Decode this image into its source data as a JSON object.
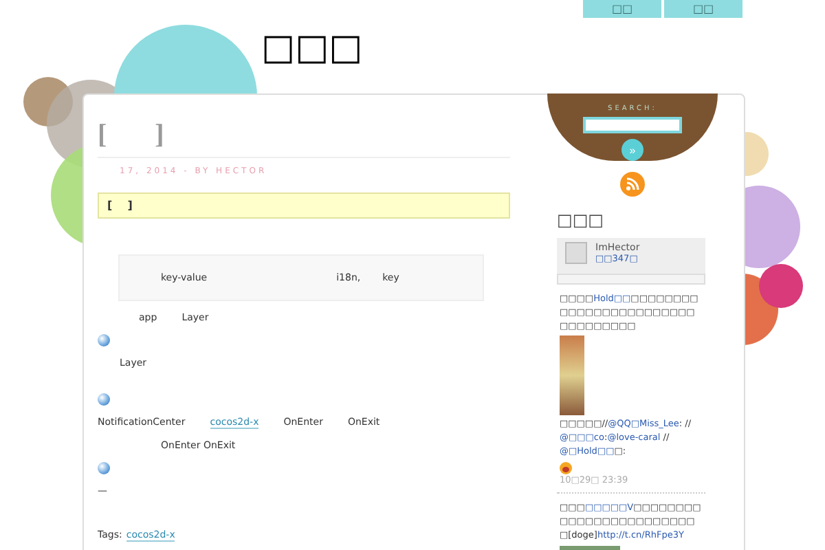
{
  "nav": [
    {
      "label": "□□"
    },
    {
      "label": "□□"
    }
  ],
  "site_title": "□□□",
  "post": {
    "title": "[       ]",
    "meta": "17, 2014 - BY HECTOR",
    "notice": "[    ]",
    "quote": [
      "key-value",
      "i18n,",
      "key"
    ],
    "body": [
      {
        "kind": "para",
        "segments": [
          {
            "kind": "text",
            "text": "app"
          },
          {
            "kind": "text",
            "text": "Layer"
          }
        ]
      },
      {
        "kind": "icon"
      },
      {
        "kind": "para",
        "segments": [
          {
            "kind": "text",
            "text": "Layer"
          }
        ]
      },
      {
        "kind": "icon"
      },
      {
        "kind": "para",
        "segments": [
          {
            "kind": "text",
            "text": "NotificationCenter"
          },
          {
            "kind": "link",
            "text": "cocos2d-x"
          },
          {
            "kind": "text",
            "text": "OnEnter"
          },
          {
            "kind": "text",
            "text": "OnExit"
          }
        ]
      },
      {
        "kind": "para",
        "segments": [
          {
            "kind": "text",
            "text": "OnEnter OnExit"
          }
        ]
      },
      {
        "kind": "icon"
      },
      {
        "kind": "para",
        "segments": [
          {
            "kind": "text",
            "text": "—"
          }
        ]
      }
    ],
    "tags_label": "Tags:",
    "tag": "cocos2d-x"
  },
  "sidebar": {
    "search_label": "SEARCH:",
    "search_button": "»",
    "heading": "□□□",
    "profile": {
      "name": "ImHector",
      "followers": "□□347□"
    },
    "posts": [
      {
        "segments": [
          {
            "kind": "text",
            "text": "□□□□"
          },
          {
            "kind": "link",
            "text": "Hold□□"
          },
          {
            "kind": "text",
            "text": "□□□□□□□□□□□□□□□□□□□□□□□□□□□□□□□□□"
          }
        ],
        "repost": [
          {
            "kind": "text",
            "text": "□□□□□//"
          },
          {
            "kind": "link",
            "text": "@QQ□Miss_Lee"
          },
          {
            "kind": "text",
            "text": ": //"
          },
          {
            "kind": "link",
            "text": "@□□□co"
          },
          {
            "kind": "text",
            "text": ":"
          },
          {
            "kind": "link",
            "text": "@love-caral"
          },
          {
            "kind": "text",
            "text": " //"
          },
          {
            "kind": "link",
            "text": "@□Hold□□"
          },
          {
            "kind": "text",
            "text": "□:"
          }
        ],
        "emoji": true,
        "time": "10□29□ 23:39"
      },
      {
        "segments": [
          {
            "kind": "text",
            "text": "□□□"
          },
          {
            "kind": "link",
            "text": "□□□□□V"
          },
          {
            "kind": "text",
            "text": "□□□□□□□□□□□□□□□□□□□□□□□□□[doge]"
          },
          {
            "kind": "link",
            "text": "http://t.cn/RhFpe3Y"
          }
        ],
        "emoji": false
      }
    ]
  }
}
